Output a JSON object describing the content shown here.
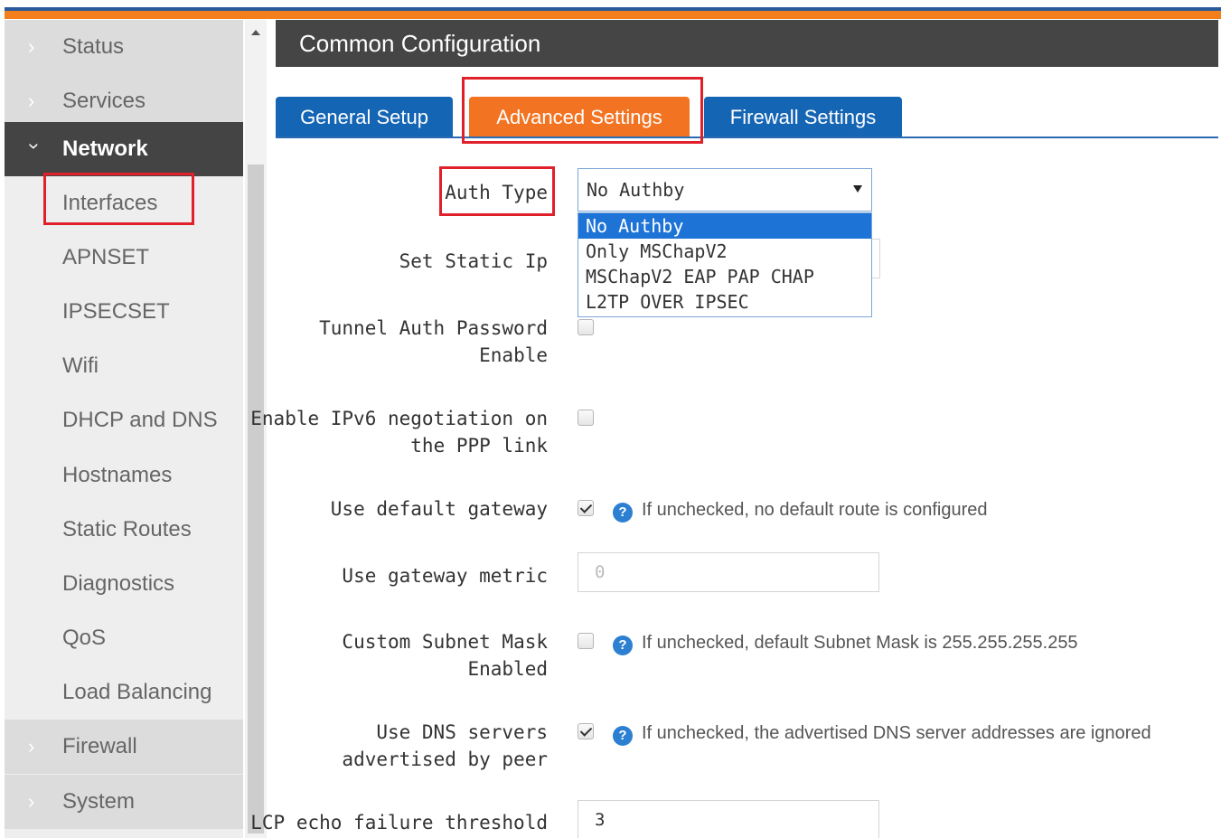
{
  "sidebar": {
    "items": [
      {
        "label": "Status"
      },
      {
        "label": "Services"
      },
      {
        "label": "Network"
      },
      {
        "label": "Interfaces"
      },
      {
        "label": "APNSET"
      },
      {
        "label": "IPSECSET"
      },
      {
        "label": "Wifi"
      },
      {
        "label": "DHCP and DNS"
      },
      {
        "label": "Hostnames"
      },
      {
        "label": "Static Routes"
      },
      {
        "label": "Diagnostics"
      },
      {
        "label": "QoS"
      },
      {
        "label": "Load Balancing"
      },
      {
        "label": "Firewall"
      },
      {
        "label": "System"
      }
    ]
  },
  "header": {
    "title": "Common Configuration"
  },
  "tabs": [
    {
      "label": "General Setup"
    },
    {
      "label": "Advanced Settings"
    },
    {
      "label": "Firewall Settings"
    }
  ],
  "form": {
    "auth_type": {
      "label": "Auth Type",
      "value": "No Authby",
      "options": [
        "No Authby",
        "Only MSChapV2",
        "MSChapV2 EAP PAP CHAP",
        "L2TP OVER IPSEC"
      ]
    },
    "static_ip": {
      "label": "Set Static Ip"
    },
    "tunnel_auth": {
      "label_1": "Tunnel Auth Password",
      "label_2": "Enable",
      "checked": false
    },
    "ipv6": {
      "label_1": "Enable IPv6 negotiation on",
      "label_2": "the PPP link",
      "checked": false
    },
    "default_gateway": {
      "label": "Use default gateway",
      "checked": true,
      "hint": "If unchecked, no default route is configured"
    },
    "gateway_metric": {
      "label": "Use gateway metric",
      "placeholder": "0"
    },
    "subnet_mask": {
      "label_1": "Custom Subnet Mask",
      "label_2": "Enabled",
      "checked": false,
      "hint": "If unchecked, default Subnet Mask is 255.255.255.255"
    },
    "dns_servers": {
      "label_1": "Use DNS servers",
      "label_2": "advertised by peer",
      "checked": true,
      "hint": "If unchecked, the advertised DNS server addresses are ignored"
    },
    "lcp_echo": {
      "label": "LCP echo failure threshold",
      "value": "3"
    }
  },
  "colors": {
    "accent_orange": "#f27422",
    "tab_blue": "#1565b5",
    "highlight_red": "#e0202a",
    "header_dark": "#454545"
  }
}
